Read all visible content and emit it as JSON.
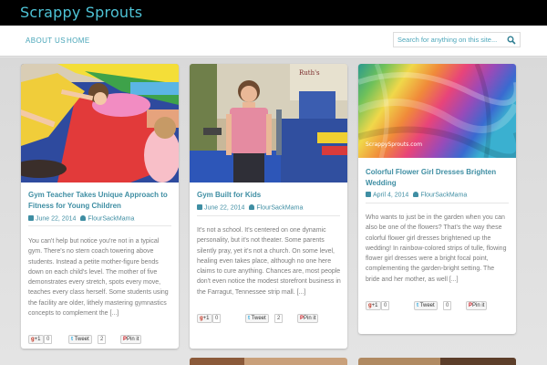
{
  "site": {
    "title": "Scrappy Sprouts"
  },
  "nav": {
    "items": [
      {
        "label": "ABOUT US"
      },
      {
        "label": "HOME"
      }
    ]
  },
  "search": {
    "placeholder": "Search for anything on this site..."
  },
  "colors": {
    "accent": "#48a5b8",
    "topbar": "#000000",
    "text": "#7c7c7c"
  },
  "posts": [
    {
      "title": "Gym Teacher Takes Unique Approach to Fitness for Young Children",
      "date": "June 22, 2014",
      "author": "FlourSackMama",
      "excerpt": "You can't help but notice you're not in a typical gym. There's no stern coach towering above students. Instead a petite mother-figure bends down on each child's level. The mother of five demonstrates every stretch, spots every move, teaches every class herself. Some students using the facility are older, lithely mastering gymnastics concepts to complement the [...]",
      "share": {
        "gplus": "+1",
        "gplus_count": "0",
        "tweet": "Tweet",
        "tweet_count": "2",
        "pin": "Pin it"
      }
    },
    {
      "title": "Gym Built for Kids",
      "date": "June 22, 2014",
      "author": "FlourSackMama",
      "excerpt": "It's not a school. It's centered on one dynamic personality, but it's not theater. Some parents silently pray, yet it's not a church. On some level, healing even takes place, although no one here claims to cure anything. Chances are, most people don't even notice the modest storefront business in the Farragut, Tennessee strip mall. [...]",
      "share": {
        "gplus": "+1",
        "gplus_count": "0",
        "tweet": "Tweet",
        "tweet_count": "2",
        "pin": "Pin it"
      }
    },
    {
      "title": "Colorful Flower Girl Dresses Brighten Wedding",
      "date": "April 4, 2014",
      "author": "FlourSackMama",
      "watermark": "ScrappySprouts.com",
      "excerpt": "Who wants to just be in the garden when you can also be one of the flowers? That's the way these colorful flower girl dresses brightened up the wedding! In rainbow-colored strips of tulle, flowing flower girl dresses were a bright focal point, complementing the garden-bright setting. The bride and her mother, as well [...]",
      "share": {
        "gplus": "+1",
        "gplus_count": "0",
        "tweet": "Tweet",
        "tweet_count": "0",
        "pin": "Pin it"
      }
    }
  ]
}
